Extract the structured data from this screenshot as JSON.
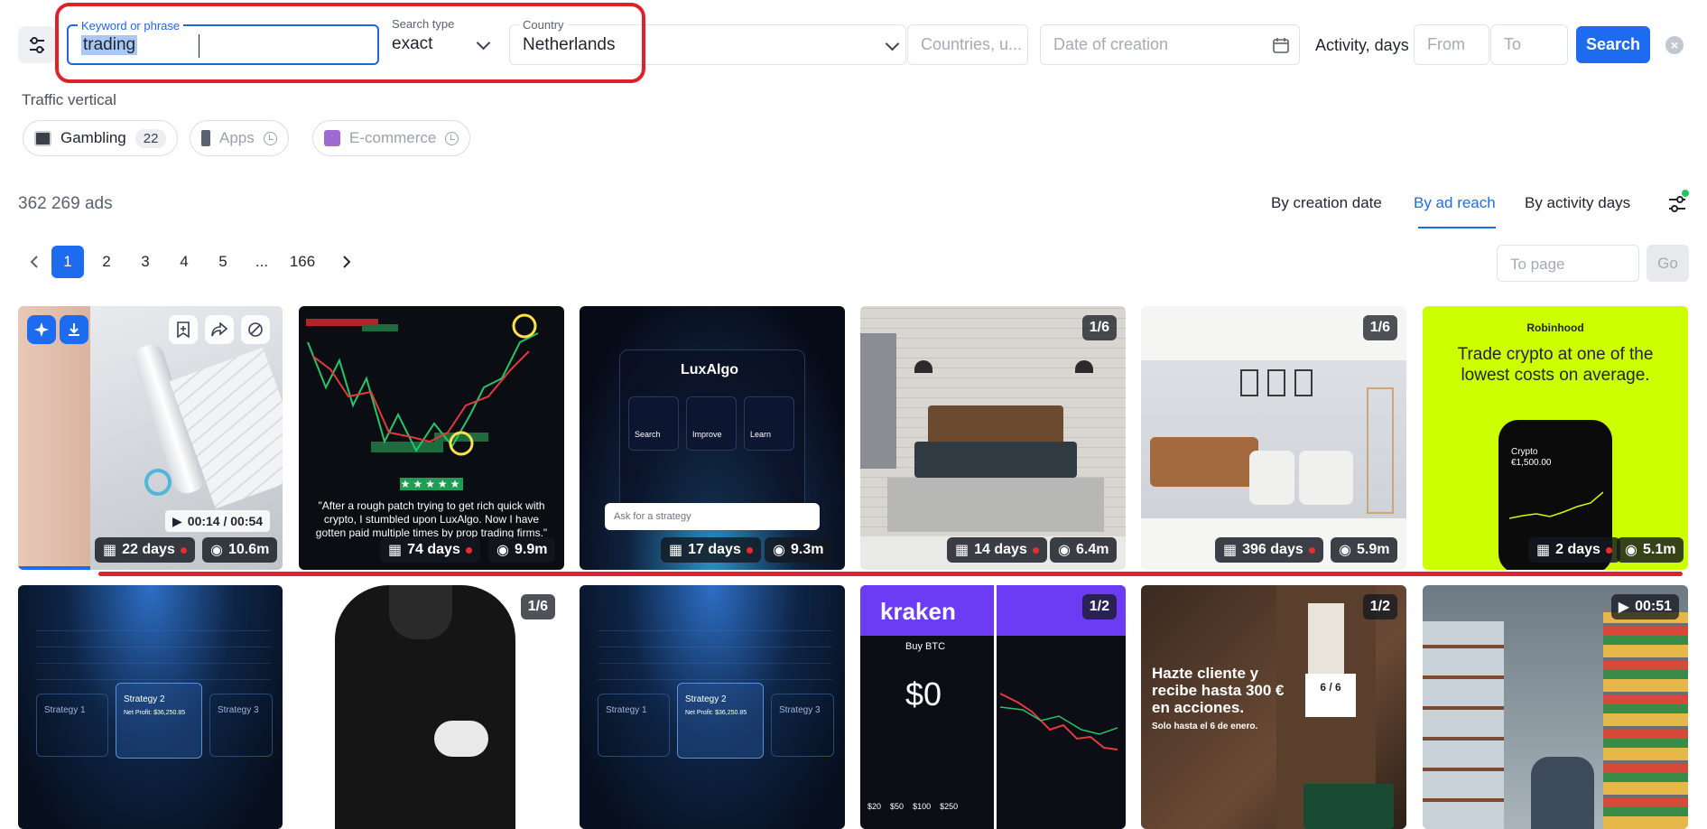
{
  "filters": {
    "keyword_label": "Keyword or phrase",
    "keyword_value": "trading",
    "search_type_label": "Search type",
    "search_type_value": "exact",
    "country_label": "Country",
    "country_value": "Netherlands",
    "countries_placeholder": "Countries, u...",
    "date_placeholder": "Date of creation",
    "activity_label": "Activity, days",
    "from_placeholder": "From",
    "to_placeholder": "To",
    "search_label": "Search"
  },
  "traffic": {
    "label": "Traffic vertical",
    "chips": [
      {
        "label": "Gambling",
        "count": "22"
      },
      {
        "label": "Apps"
      },
      {
        "label": "E-commerce"
      }
    ]
  },
  "results": {
    "count": "362 269 ads",
    "sort_options": [
      "By creation date",
      "By ad reach",
      "By activity days"
    ],
    "active_sort": "By ad reach"
  },
  "pagination": {
    "pages": [
      "1",
      "2",
      "3",
      "4",
      "5",
      "...",
      "166"
    ],
    "current": "1",
    "to_page_placeholder": "To page",
    "go_label": "Go"
  },
  "cards_row1": [
    {
      "duration": "00:14 / 00:54",
      "days": "22 days",
      "reach": "10.6m"
    },
    {
      "quote": "\"After a rough patch trying to get rich quick with crypto, I stumbled upon LuxAlgo. Now I have gotten paid multiple times by prop trading firms.\"",
      "days": "74 days",
      "reach": "9.9m"
    },
    {
      "brand": "LuxAlgo",
      "features": [
        "Search",
        "Improve",
        "Learn"
      ],
      "prompt": "Ask for a strategy",
      "days": "17 days",
      "reach": "9.3m"
    },
    {
      "page": "1/6",
      "days": "14 days",
      "reach": "6.4m"
    },
    {
      "page": "1/6",
      "days": "396 days",
      "reach": "5.9m"
    },
    {
      "brand": "Robinhood",
      "headline": "Trade crypto at one of the lowest costs on average.",
      "phone_label": "Crypto",
      "phone_value": "€1,500.00",
      "days": "2 days",
      "reach": "5.1m"
    }
  ],
  "cards_row2": [
    {
      "strategies": [
        "Strategy 1",
        "Strategy 2",
        "Strategy 3"
      ],
      "net_profit": "Net Profit: $36,250.85"
    },
    {
      "page": "1/6"
    },
    {
      "strategies": [
        "Strategy 1",
        "Strategy 2",
        "Strategy 3"
      ],
      "net_profit": "Net Profit: $36,250.85"
    },
    {
      "page": "1/2",
      "brand": "kraken",
      "buy": "Buy BTC",
      "amount": "$0",
      "amounts": [
        "$20",
        "$50",
        "$100",
        "$250"
      ]
    },
    {
      "page": "1/2",
      "headline": "Hazte cliente y recibe hasta 300 € en acciones.",
      "sub": "Solo hasta el 6 de enero.",
      "tag": "6 / 6"
    },
    {
      "duration": "00:51"
    }
  ],
  "colors": {
    "accent": "#1d6cf0",
    "highlight": "#e0202a",
    "robinhood": "#ccff00"
  }
}
